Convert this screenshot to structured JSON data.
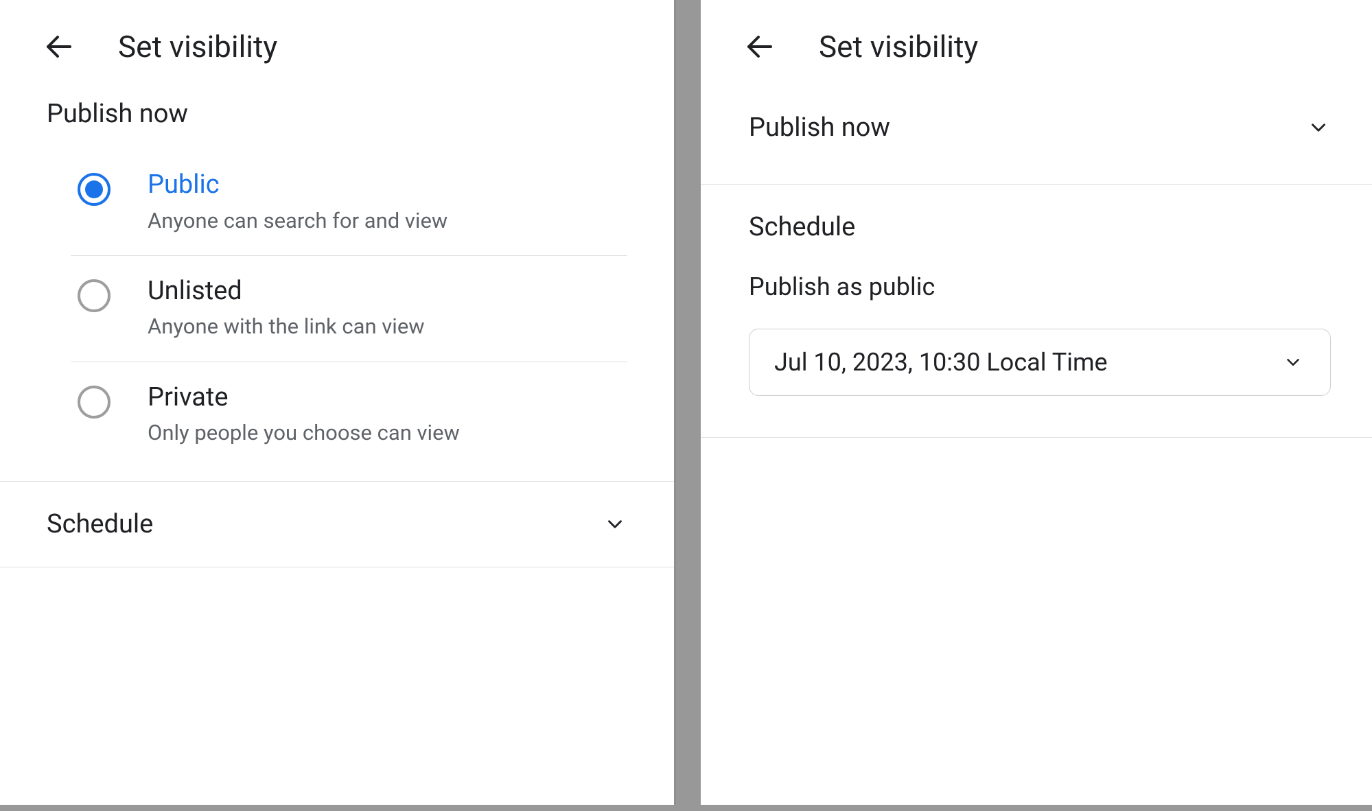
{
  "left": {
    "title": "Set visibility",
    "publish_label": "Publish now",
    "options": [
      {
        "title": "Public",
        "sub": "Anyone can search for and view",
        "selected": true
      },
      {
        "title": "Unlisted",
        "sub": "Anyone with the link can view",
        "selected": false
      },
      {
        "title": "Private",
        "sub": "Only people you choose can view",
        "selected": false
      }
    ],
    "schedule_label": "Schedule"
  },
  "right": {
    "title": "Set visibility",
    "publish_label": "Publish now",
    "schedule_label": "Schedule",
    "publish_as_label": "Publish as public",
    "datetime": "Jul 10, 2023, 10:30 Local Time"
  }
}
